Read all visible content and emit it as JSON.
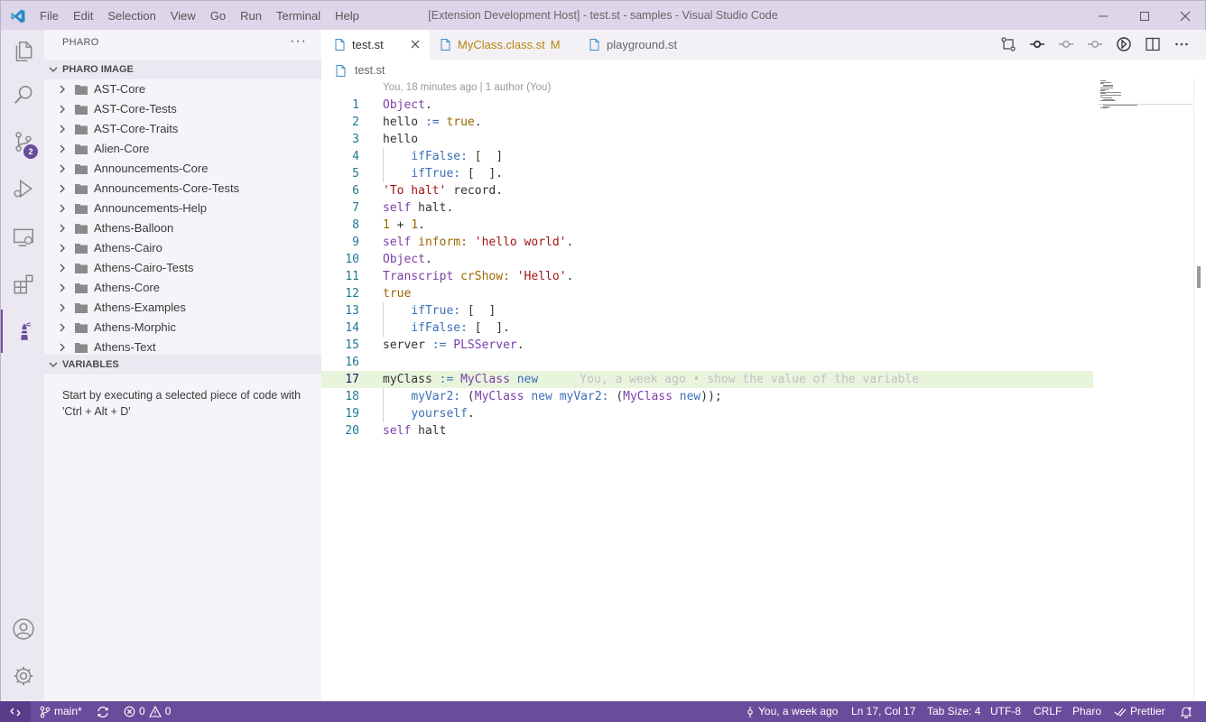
{
  "window": {
    "title": "[Extension Development Host] - test.st - samples - Visual Studio Code"
  },
  "menu": [
    "File",
    "Edit",
    "Selection",
    "View",
    "Go",
    "Run",
    "Terminal",
    "Help"
  ],
  "activity": {
    "scm_badge": "2"
  },
  "sidebar": {
    "title": "PHARO",
    "more": "···",
    "image_section": "PHARO IMAGE",
    "packages": [
      "AST-Core",
      "AST-Core-Tests",
      "AST-Core-Traits",
      "Alien-Core",
      "Announcements-Core",
      "Announcements-Core-Tests",
      "Announcements-Help",
      "Athens-Balloon",
      "Athens-Cairo",
      "Athens-Cairo-Tests",
      "Athens-Core",
      "Athens-Examples",
      "Athens-Morphic",
      "Athens-Text"
    ],
    "variables_section": "VARIABLES",
    "variables_message": "Start by executing a selected piece of code with 'Ctrl + Alt + D'"
  },
  "tabs": [
    {
      "label": "test.st",
      "modified": ""
    },
    {
      "label": "MyClass.class.st",
      "modified": "M"
    },
    {
      "label": "playground.st",
      "modified": ""
    }
  ],
  "breadcrumb": "test.st",
  "editor": {
    "blame_header": "You, 18 minutes ago | 1 author (You)",
    "current_line": 17,
    "lines": [
      {
        "n": "1",
        "text": "Object."
      },
      {
        "n": "2",
        "text": "hello := true."
      },
      {
        "n": "3",
        "text": "hello"
      },
      {
        "n": "4",
        "text": "    ifFalse: [  ]"
      },
      {
        "n": "5",
        "text": "    ifTrue: [  ]."
      },
      {
        "n": "6",
        "text": "'To halt' record."
      },
      {
        "n": "7",
        "text": "self halt."
      },
      {
        "n": "8",
        "text": "1 + 1."
      },
      {
        "n": "9",
        "text": "self inform: 'hello world'."
      },
      {
        "n": "10",
        "text": "Object."
      },
      {
        "n": "11",
        "text": "Transcript crShow: 'Hello'."
      },
      {
        "n": "12",
        "text": "true"
      },
      {
        "n": "13",
        "text": "    ifTrue: [  ]"
      },
      {
        "n": "14",
        "text": "    ifFalse: [  ]."
      },
      {
        "n": "15",
        "text": "server := PLSServer."
      },
      {
        "n": "16",
        "text": ""
      },
      {
        "n": "17",
        "text": "myClass := MyClass new",
        "blame": "You, a week ago • show the value of the variable"
      },
      {
        "n": "18",
        "text": "    myVar2: (MyClass new myVar2: (MyClass new));"
      },
      {
        "n": "19",
        "text": "    yourself."
      },
      {
        "n": "20",
        "text": "self halt"
      }
    ]
  },
  "status": {
    "branch": "main*",
    "errors": "0",
    "warnings": "0",
    "blame": "You, a week ago",
    "position": "Ln 17, Col 17",
    "tab_size": "Tab Size: 4",
    "encoding": "UTF-8",
    "eol": "CRLF",
    "language": "Pharo",
    "formatter": "Prettier"
  },
  "colors": {
    "accent": "#6a4c9c",
    "titlebar": "#ddd6e8",
    "current_line": "#e9f4dc",
    "line_number": "#237893"
  }
}
